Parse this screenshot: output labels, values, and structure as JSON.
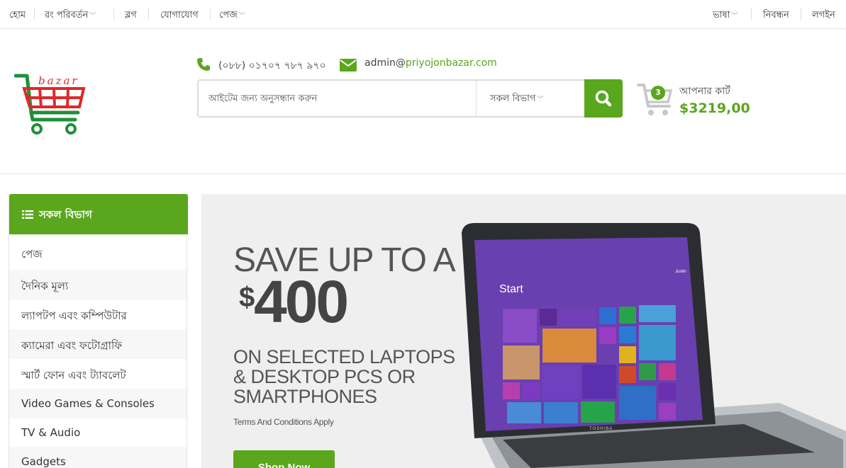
{
  "topbar": {
    "home": "হোম",
    "color_change": "রং পরিবর্তন",
    "blog": "ব্লগ",
    "contact": "যোগাযোগ",
    "pages": "পেজ",
    "language": "ভাষা",
    "register": "নিবন্ধন",
    "login": "লগইন"
  },
  "header": {
    "logo_text": "bazar",
    "phone": "(০৮৮) ০১৭০৭ ৭৮৭ ৯৭০",
    "email_prefix": "admin@",
    "email_domain": "priyojonbazar.com",
    "search": {
      "placeholder": "আইটেম জন্য অনুসন্ধান করুন",
      "category": "সকল বিভাগ"
    },
    "cart": {
      "count": "3",
      "label": "আপনার কার্ট",
      "total": "$3219,00"
    }
  },
  "sidebar": {
    "title": "সকল বিভাগ",
    "items": [
      {
        "label": "পেজ"
      },
      {
        "label": "দৈনিক মূল্য"
      },
      {
        "label": "ল্যাপটপ এবং কম্পিউটার"
      },
      {
        "label": "ক্যামেরা এবং ফটোগ্রাফি"
      },
      {
        "label": "স্মার্ট ফোন এবং ট্যাবলেট"
      },
      {
        "label": "Video Games & Consoles"
      },
      {
        "label": "TV & Audio"
      },
      {
        "label": "Gadgets"
      }
    ]
  },
  "banner": {
    "title": "SAVE UP TO A",
    "currency": "$",
    "amount": "400",
    "subtitle": "ON SELECTED LAPTOPS & DESKTOP PCS OR SMARTPHONES",
    "terms": "Terms And Conditions Apply",
    "cta": "Shop Now",
    "screen_start": "Start",
    "screen_user": "Justin",
    "laptop_brand": "TOSHIBA"
  },
  "icons": {
    "phone": "phone-icon",
    "email": "envelope-icon",
    "search": "search-icon",
    "cart": "cart-icon",
    "menu": "list-icon"
  },
  "colors": {
    "accent": "#5aa61d",
    "logo_red": "#e02828",
    "logo_green": "#1f8f3a"
  }
}
